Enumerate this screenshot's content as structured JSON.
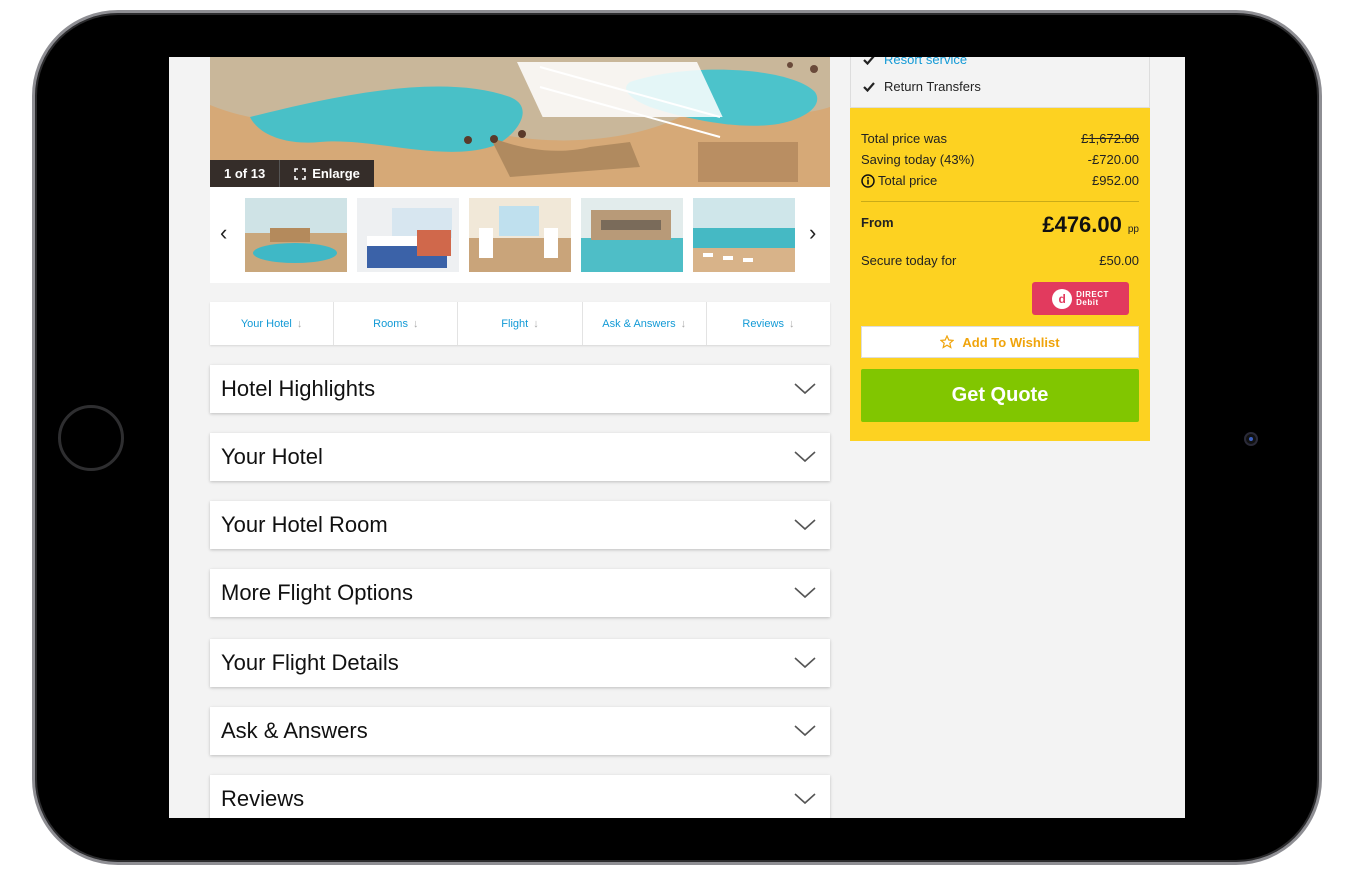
{
  "gallery": {
    "counter": "1 of 13",
    "enlarge_label": "Enlarge"
  },
  "tabs": [
    {
      "label": "Your Hotel"
    },
    {
      "label": "Rooms"
    },
    {
      "label": "Flight"
    },
    {
      "label": "Ask & Answers"
    },
    {
      "label": "Reviews"
    }
  ],
  "sections": [
    {
      "title": "Hotel Highlights"
    },
    {
      "title": "Your Hotel"
    },
    {
      "title": "Your Hotel Room"
    },
    {
      "title": "More Flight Options"
    },
    {
      "title": "Your Flight Details"
    },
    {
      "title": "Ask & Answers"
    },
    {
      "title": "Reviews"
    }
  ],
  "inclusions": [
    {
      "label": "Resort service",
      "icon": "check-icon"
    },
    {
      "label": "Return Transfers",
      "icon": "check-icon"
    }
  ],
  "pricing": {
    "was_label": "Total price was",
    "was_value": "£1,672.00",
    "saving_label": "Saving today (43%)",
    "saving_value": "-£720.00",
    "total_label": "Total price",
    "total_value": "£952.00",
    "from_label": "From",
    "from_value": "£476.00",
    "pp": "pp",
    "secure_label": "Secure today for",
    "secure_value": "£50.00",
    "direct_debit_line1": "DIRECT",
    "direct_debit_line2": "Debit"
  },
  "actions": {
    "wishlist": "Add To Wishlist",
    "quote": "Get Quote"
  },
  "colors": {
    "accent_blue": "#139ad6",
    "price_panel": "#fdd221",
    "quote_green": "#81c600",
    "wishlist_orange": "#f0a40b",
    "direct_debit_red": "#e23a5e"
  }
}
